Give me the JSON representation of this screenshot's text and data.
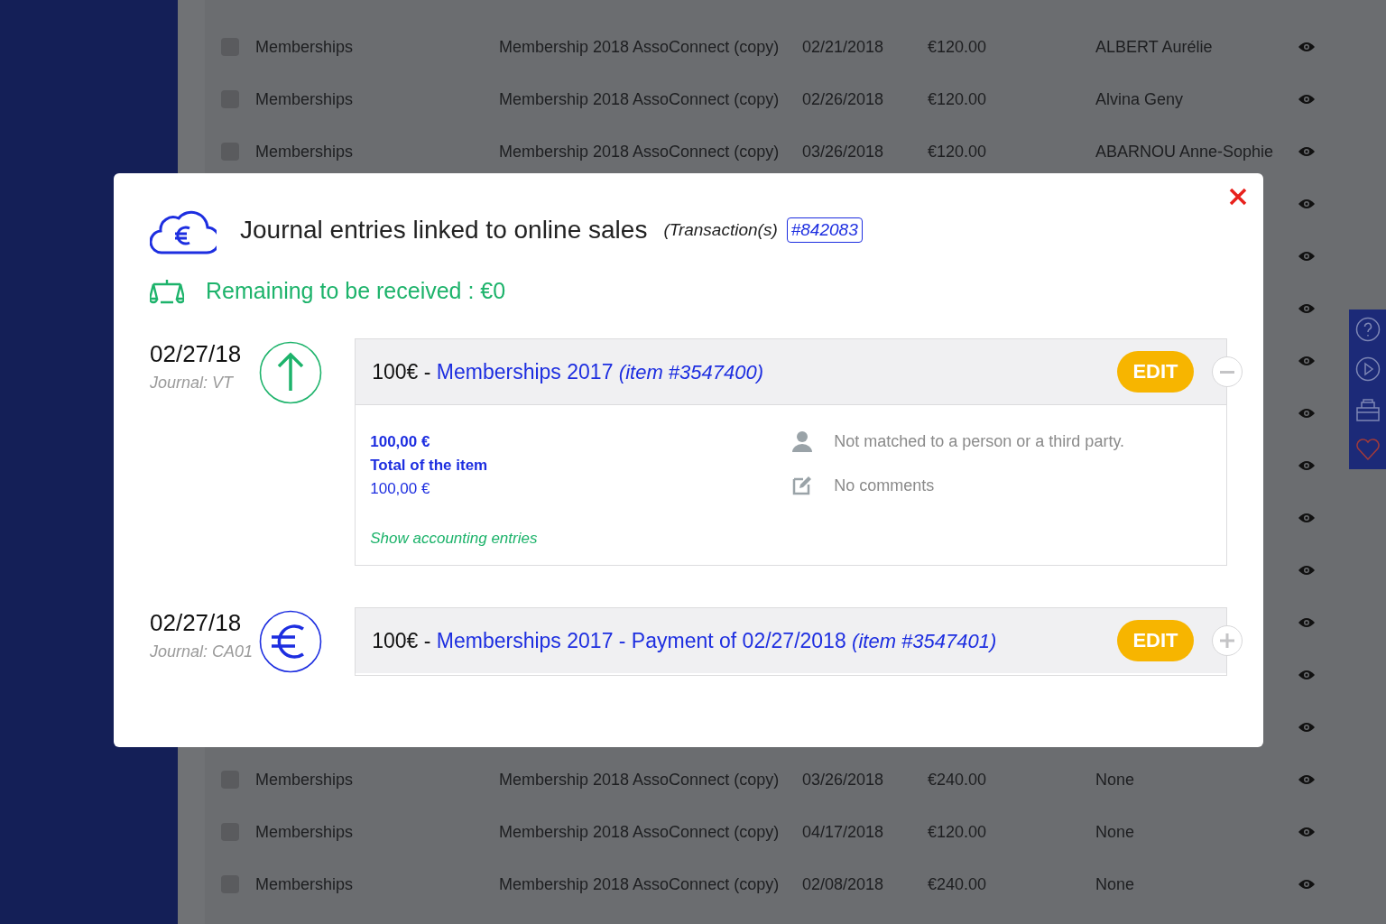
{
  "table": {
    "rows": [
      {
        "checked": false,
        "cells": [
          "Memberships",
          "Membership 2018 AssoConnect (copy)",
          "02/21/2018",
          "€120.00",
          "ALBERT Aurélie"
        ]
      },
      {
        "checked": false,
        "cells": [
          "Memberships",
          "Membership 2018 AssoConnect (copy)",
          "02/26/2018",
          "€120.00",
          "Alvina Geny"
        ]
      },
      {
        "checked": false,
        "cells": [
          "Memberships",
          "Membership 2018 AssoConnect (copy)",
          "03/26/2018",
          "€120.00",
          "ABARNOU Anne-Sophie"
        ]
      },
      {},
      {},
      {},
      {},
      {},
      {},
      {},
      {},
      {},
      {},
      {},
      {
        "checked": false,
        "cells": [
          "Memberships",
          "Membership 2018 AssoConnect (copy)",
          "03/26/2018",
          "€240.00",
          "None"
        ]
      },
      {
        "checked": false,
        "cells": [
          "Memberships",
          "Membership 2018 AssoConnect (copy)",
          "04/17/2018",
          "€120.00",
          "None"
        ]
      },
      {
        "checked": false,
        "cells": [
          "Memberships",
          "Membership 2018 AssoConnect (copy)",
          "02/08/2018",
          "€240.00",
          "None"
        ]
      }
    ]
  },
  "modal": {
    "title": "Journal entries linked to online sales",
    "subtitle": "(Transaction(s)",
    "transaction": "#842083",
    "remaining": "Remaining to be received : €0",
    "entries": [
      {
        "date": "02/27/18",
        "journal": "Journal: VT",
        "kind": "arrow",
        "amount": "100€ -",
        "name": "Memberships 2017",
        "item": "(item #3547400)",
        "edit": "EDIT",
        "expanded": true,
        "details": {
          "value": "100,00 €",
          "total_label": "Total of the item",
          "total": "100,00 €",
          "link": "Show accounting entries",
          "person": "Not matched to a person or a third party.",
          "comments": "No comments"
        }
      },
      {
        "date": "02/27/18",
        "journal": "Journal: CA01",
        "kind": "euro",
        "amount": "100€ -",
        "name": "Memberships 2017 - Payment of 02/27/2018",
        "item": "(item #3547401)",
        "edit": "EDIT",
        "expanded": false
      }
    ]
  }
}
